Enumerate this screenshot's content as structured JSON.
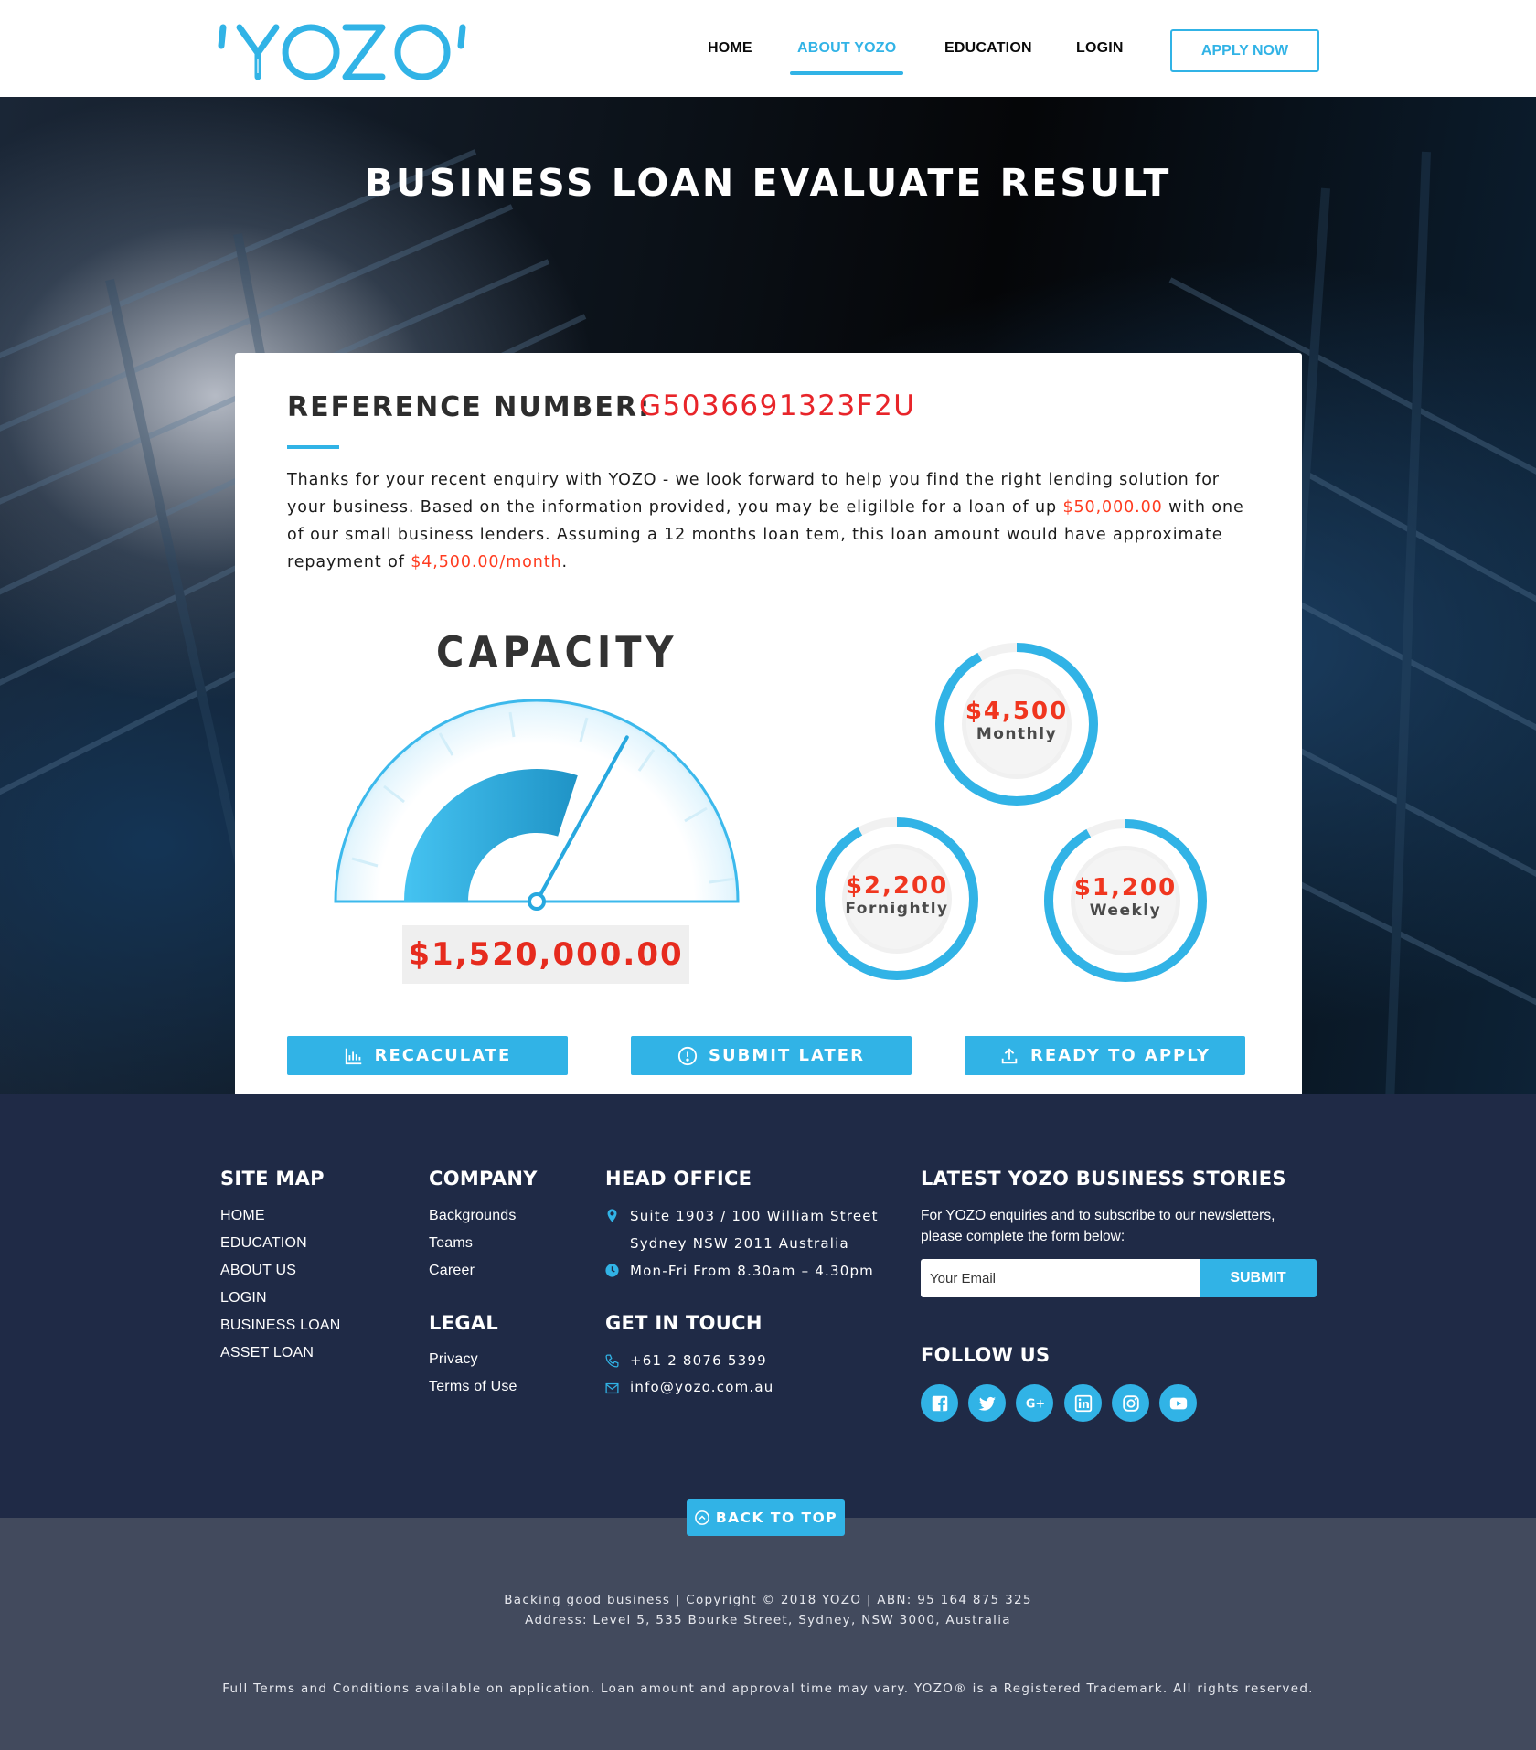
{
  "header": {
    "logo_text": "'YOZO'",
    "nav": [
      {
        "label": "HOME",
        "active": false
      },
      {
        "label": "ABOUT YOZO",
        "active": true
      },
      {
        "label": "EDUCATION",
        "active": false
      },
      {
        "label": "LOGIN",
        "active": false
      }
    ],
    "apply_label": "APPLY NOW",
    "accent": "#31b3e6"
  },
  "hero": {
    "title": "BUSINESS LOAN EVALUATE RESULT"
  },
  "result": {
    "ref_label": "REFERENCE NUMBER:",
    "ref_value": "G5036691323F2U",
    "intro_1": "Thanks for your recent enquiry with YOZO - we look forward to help you find the right lending solution for your business. Based on the information provided, you may be eligilble for a loan of up ",
    "loan_amount": "$50,000.00",
    "intro_2": " with one of our small business lenders. Assuming a 12 months loan tem, this loan amount would have approximate repayment of ",
    "repayment": "$4,500.00/month",
    "intro_3": ".",
    "capacity_title": "CAPACITY",
    "capacity_value": "$1,520,000.00",
    "capacity_level": 0.6,
    "rings": [
      {
        "amount": "$4,500",
        "period": "Monthly",
        "fill": 0.92
      },
      {
        "amount": "$2,200",
        "period": "Fornightly",
        "fill": 0.92
      },
      {
        "amount": "$1,200",
        "period": "Weekly",
        "fill": 0.92
      }
    ],
    "buttons": [
      {
        "label": "RECACULATE",
        "icon": "bar-chart-icon"
      },
      {
        "label": "SUBMIT LATER",
        "icon": "alert-circle-icon"
      },
      {
        "label": "READY TO APPLY",
        "icon": "upload-icon"
      }
    ]
  },
  "footer": {
    "sitemap": {
      "title": "SITE MAP",
      "links": [
        "HOME",
        "EDUCATION",
        "ABOUT US",
        "LOGIN",
        "BUSINESS LOAN",
        "ASSET LOAN"
      ]
    },
    "company": {
      "title": "COMPANY",
      "links": [
        "Backgrounds",
        "Teams",
        "Career"
      ]
    },
    "legal": {
      "title": "LEGAL",
      "links": [
        "Privacy",
        "Terms of Use"
      ]
    },
    "head_office": {
      "title": "HEAD OFFICE",
      "address_1": "Suite 1903 / 100 William Street",
      "address_2": "Sydney NSW 2011 Australia",
      "hours": "Mon-Fri From 8.30am – 4.30pm"
    },
    "contact": {
      "title": "GET IN TOUCH",
      "phone": "+61 2 8076 5399",
      "email": "info@yozo.com.au"
    },
    "newsletter": {
      "title": "LATEST YOZO BUSINESS STORIES",
      "text_1": "For YOZO enquiries and to subscribe to our newsletters,",
      "text_2": "please complete the form below:",
      "placeholder": "Your Email",
      "submit": "SUBMIT"
    },
    "follow": {
      "title": "FOLLOW US",
      "icons": [
        "facebook-icon",
        "twitter-icon",
        "google-plus-icon",
        "linkedin-icon",
        "instagram-icon",
        "youtube-icon"
      ]
    },
    "back_to_top": "BACK TO TOP",
    "copyright_1": "Backing good business | Copyright © 2018 YOZO | ABN: 95 164 875 325",
    "copyright_2": "Address: Level 5, 535 Bourke Street, Sydney, NSW 3000, Australia",
    "disclaimer": "Full Terms and Conditions available on application. Loan amount and approval time may vary. YOZO® is a Registered Trademark. All rights reserved."
  }
}
